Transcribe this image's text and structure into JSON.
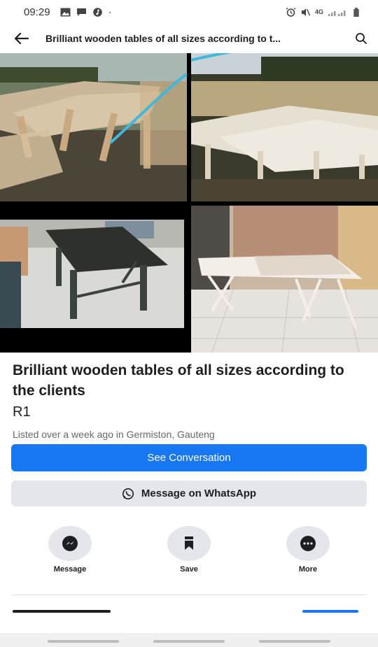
{
  "status_bar": {
    "time": "09:29",
    "network": "4G",
    "left_icons": [
      "gallery-icon",
      "message-icon",
      "music-icon"
    ],
    "right_icons": [
      "alarm-icon",
      "mute-icon",
      "signal-icon",
      "battery-icon"
    ]
  },
  "header": {
    "title": "Brilliant wooden tables of all sizes according to t...",
    "back_icon": "back-arrow-icon",
    "search_icon": "search-icon"
  },
  "photos": [
    "table-photo-1",
    "table-photo-2",
    "table-photo-3",
    "table-photo-4"
  ],
  "listing": {
    "title": "Brilliant wooden tables of all sizes according to the clients",
    "price": "R1",
    "meta": "Listed over a week ago in Germiston, Gauteng"
  },
  "buttons": {
    "see_conversation": "See Conversation",
    "whatsapp": "Message on WhatsApp"
  },
  "actions": [
    {
      "label": "Message",
      "icon": "messenger-icon"
    },
    {
      "label": "Save",
      "icon": "bookmark-icon"
    },
    {
      "label": "More",
      "icon": "more-icon"
    }
  ],
  "colors": {
    "accent": "#1877f2",
    "secondary_button": "#e4e6eb",
    "text": "#1c1e21",
    "muted_text": "#65676b"
  }
}
